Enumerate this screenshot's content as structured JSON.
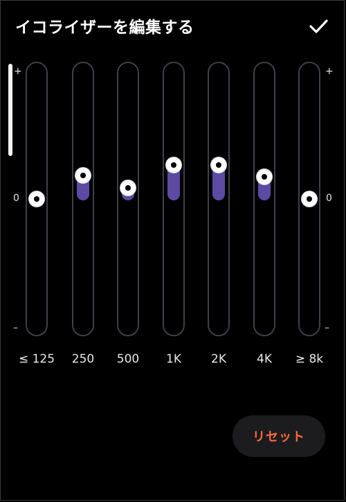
{
  "header": {
    "title": "イコライザーを編集する",
    "done_icon": "checkmark-icon"
  },
  "scale": {
    "plus": "+",
    "zero": "0",
    "minus": "–"
  },
  "bands": [
    {
      "label": "≤ 125",
      "level": 0.0
    },
    {
      "label": "250",
      "level": 0.19
    },
    {
      "label": "500",
      "level": 0.09
    },
    {
      "label": "1K",
      "level": 0.27
    },
    {
      "label": "2K",
      "level": 0.27
    },
    {
      "label": "4K",
      "level": 0.18
    },
    {
      "label": "≥ 8k",
      "level": 0.0
    }
  ],
  "reset_label": "リセット",
  "colors": {
    "accent_fill": "#5d4aa3",
    "reset_text": "#ff6a3d",
    "background": "#000000"
  }
}
